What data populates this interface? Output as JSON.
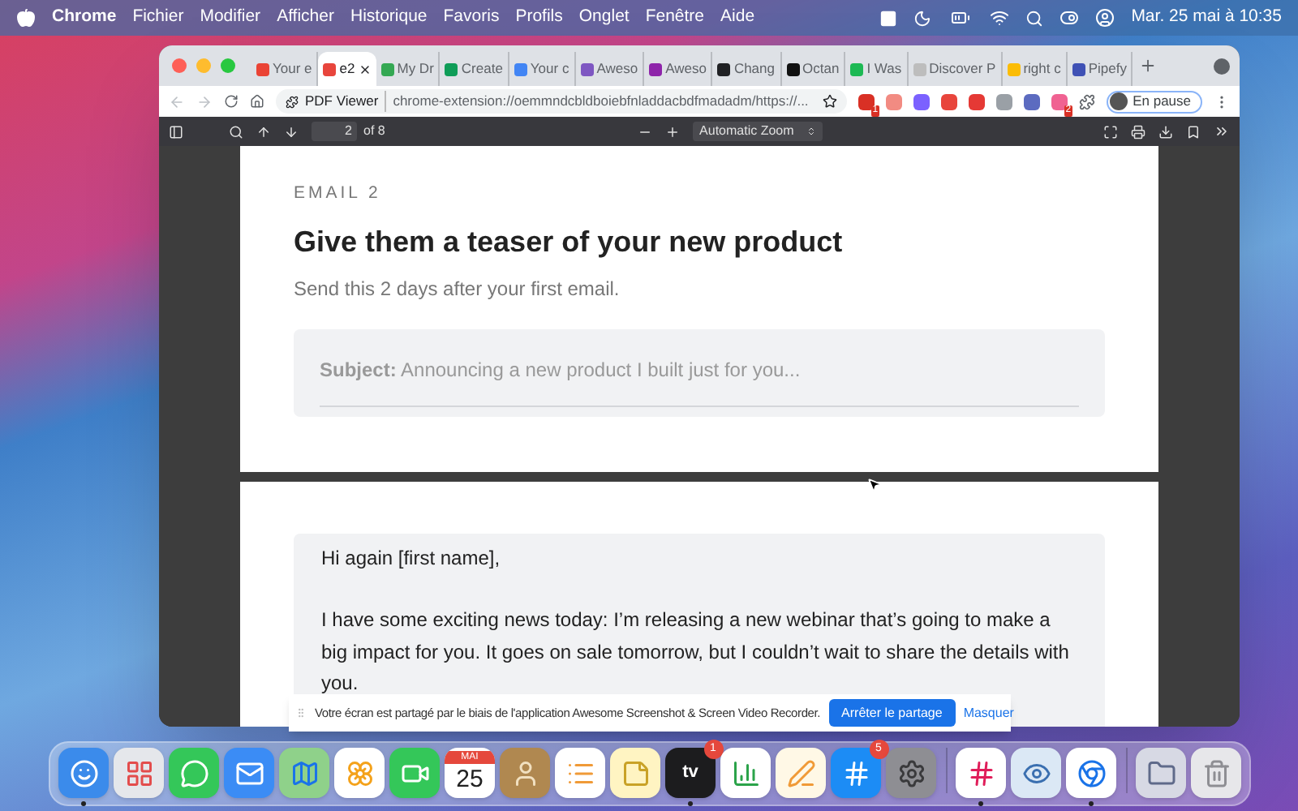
{
  "menubar": {
    "app": "Chrome",
    "menus": [
      "Fichier",
      "Modifier",
      "Afficher",
      "Historique",
      "Favoris",
      "Profils",
      "Onglet",
      "Fenêtre",
      "Aide"
    ],
    "clock": "Mar. 25 mai à 10:35"
  },
  "tabs": [
    {
      "title": "Your e",
      "color": "#ea4335",
      "selected": false
    },
    {
      "title": "e2",
      "color": "#e8453c",
      "selected": true
    },
    {
      "title": "My Dr",
      "color": "#34a853",
      "selected": false
    },
    {
      "title": "Create",
      "color": "#0f9d58",
      "selected": false
    },
    {
      "title": "Your c",
      "color": "#4285f4",
      "selected": false
    },
    {
      "title": "Aweso",
      "color": "#7e57c2",
      "selected": false
    },
    {
      "title": "Aweso",
      "color": "#8e24aa",
      "selected": false
    },
    {
      "title": "Chang",
      "color": "#202124",
      "selected": false
    },
    {
      "title": "Octan",
      "color": "#111111",
      "selected": false
    },
    {
      "title": "I Was",
      "color": "#1db954",
      "selected": false
    },
    {
      "title": "Discover P",
      "color": "#bdbdbd",
      "selected": false
    },
    {
      "title": "right c",
      "color": "#fbbc05",
      "selected": false
    },
    {
      "title": "Pipefy",
      "color": "#3f51b5",
      "selected": false
    }
  ],
  "omnibox": {
    "label": "PDF Viewer",
    "url": "chrome-extension://oemmndcbldboiebfnladdacbdfmadadm/https://..."
  },
  "extensions": [
    {
      "color": "#d93025",
      "badge": "1"
    },
    {
      "color": "#f28b82"
    },
    {
      "color": "#7b61ff"
    },
    {
      "color": "#e8453c"
    },
    {
      "color": "#e53935"
    },
    {
      "color": "#9aa0a6"
    },
    {
      "color": "#5c6bc0"
    },
    {
      "color": "#f06292",
      "badge": "2"
    }
  ],
  "profile": {
    "label": "En pause"
  },
  "pdf_toolbar": {
    "page": "2",
    "page_count": "of 8",
    "zoom": "Automatic Zoom"
  },
  "page_1": {
    "eyebrow": "EMAIL 2",
    "title": "Give them a teaser of your new product",
    "subtitle": "Send this 2 days after your first email.",
    "subject": "**Subject:** Announcing a new product I built just for you..."
  },
  "page_2": {
    "greeting": "Hi again [first name],",
    "paragraph": "I have some exciting news today: I’m releasing a new webinar that’s going to make a big impact for you. It goes on sale tomorrow, but I couldn’t wait to share the details with you."
  },
  "share_bar": {
    "message": "Votre écran est partagé par le biais de l'application Awesome Screenshot & Screen Video Recorder.",
    "stop": "Arrêter le partage",
    "hide": "Masquer"
  },
  "dock": {
    "apps": [
      {
        "kind": "finder",
        "running": true
      },
      {
        "kind": "launchpad",
        "running": false
      },
      {
        "kind": "messages",
        "running": false
      },
      {
        "kind": "mail",
        "running": false
      },
      {
        "kind": "maps",
        "running": false
      },
      {
        "kind": "photos",
        "running": false
      },
      {
        "kind": "facetime",
        "running": false
      },
      {
        "kind": "calendar",
        "running": false,
        "month": "MAI",
        "day": "25"
      },
      {
        "kind": "contacts",
        "running": false
      },
      {
        "kind": "reminders",
        "running": false
      },
      {
        "kind": "notes",
        "running": false
      },
      {
        "kind": "tv",
        "running": true,
        "label": "tv",
        "badge": "1"
      },
      {
        "kind": "numbers",
        "running": false
      },
      {
        "kind": "pages",
        "running": false
      },
      {
        "kind": "appstore",
        "running": false,
        "badge": "5"
      },
      {
        "kind": "settings",
        "running": false
      }
    ],
    "recent": [
      {
        "kind": "slack",
        "running": true
      },
      {
        "kind": "preview",
        "running": false
      },
      {
        "kind": "chrome",
        "running": true
      }
    ],
    "stack": [
      {
        "kind": "folder",
        "running": false
      },
      {
        "kind": "trash",
        "running": false
      }
    ]
  }
}
